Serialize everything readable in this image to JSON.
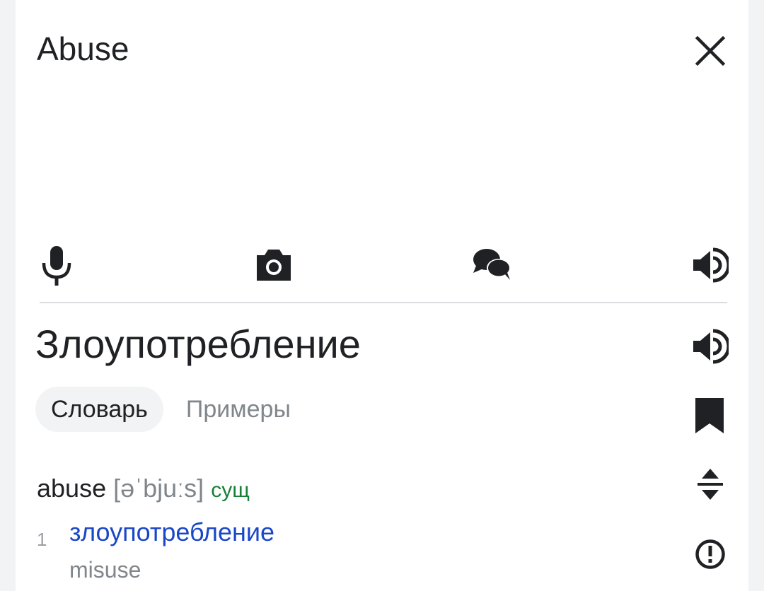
{
  "source": {
    "text": "Abuse"
  },
  "toolbar": {
    "icons": [
      "microphone-icon",
      "camera-icon",
      "conversation-icon",
      "speaker-icon"
    ]
  },
  "result": {
    "translation": "Злоупотребление"
  },
  "tabs": [
    {
      "label": "Словарь",
      "active": true
    },
    {
      "label": "Примеры",
      "active": false
    }
  ],
  "dictionary": {
    "word": "abuse",
    "ipa": "[əˈbjuːs]",
    "pos": "сущ",
    "senses": [
      {
        "number": "1",
        "translation": "злоупотребление",
        "synonyms": "misuse"
      }
    ]
  },
  "colors": {
    "accent": "#1a47c8",
    "pos": "#188038",
    "muted": "#80868b",
    "icon": "#202124"
  }
}
